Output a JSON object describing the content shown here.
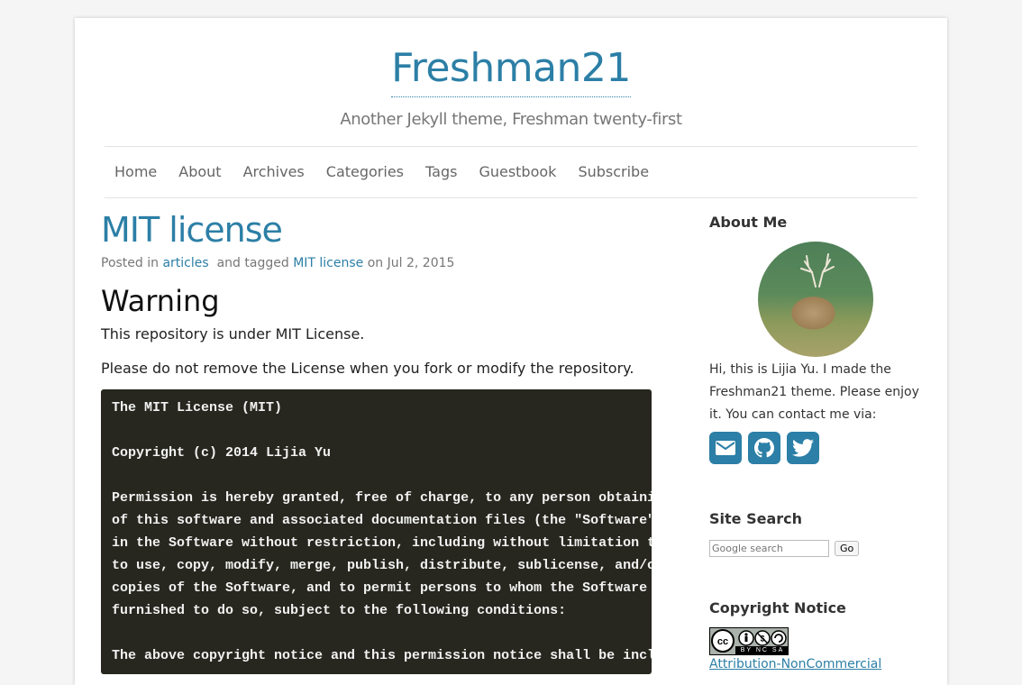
{
  "site": {
    "title": "Freshman21",
    "tagline": "Another Jekyll theme, Freshman twenty-first"
  },
  "nav": [
    "Home",
    "About",
    "Archives",
    "Categories",
    "Tags",
    "Guestbook",
    "Subscribe"
  ],
  "post": {
    "title": "MIT license",
    "meta": {
      "posted_in": "Posted in",
      "category": "articles",
      "and_tagged": "and tagged",
      "tag": "MIT license",
      "on": "on",
      "date": "Jul 2, 2015"
    },
    "heading": "Warning",
    "para1": "This repository is under MIT License.",
    "para2": "Please do not remove the License when you fork or modify the repository.",
    "code_lines": [
      "The MIT License (MIT)",
      "",
      "Copyright (c) 2014 Lijia Yu",
      "",
      "Permission is hereby granted, free of charge, to any person obtaini",
      "of this software and associated documentation files (the \"Software\"",
      "in the Software without restriction, including without limitation t",
      "to use, copy, modify, merge, publish, distribute, sublicense, and/o",
      "copies of the Software, and to permit persons to whom the Software",
      "furnished to do so, subject to the following conditions:",
      "",
      "The above copyright notice and this permission notice shall be incl"
    ]
  },
  "sidebar": {
    "about": {
      "title": "About Me",
      "text": "Hi, this is Lijia Yu. I made the Freshman21 theme. Please enjoy it. You can contact me via:",
      "icons": [
        "envelope-icon",
        "github-icon",
        "twitter-icon"
      ]
    },
    "search": {
      "title": "Site Search",
      "placeholder": "Google search",
      "button": "Go"
    },
    "copyright": {
      "title": "Copyright Notice",
      "badge_text": "BY NC SA",
      "link": "Attribution-NonCommercial"
    }
  },
  "colors": {
    "accent": "#2c7fa6",
    "code_bg": "#27271f"
  }
}
